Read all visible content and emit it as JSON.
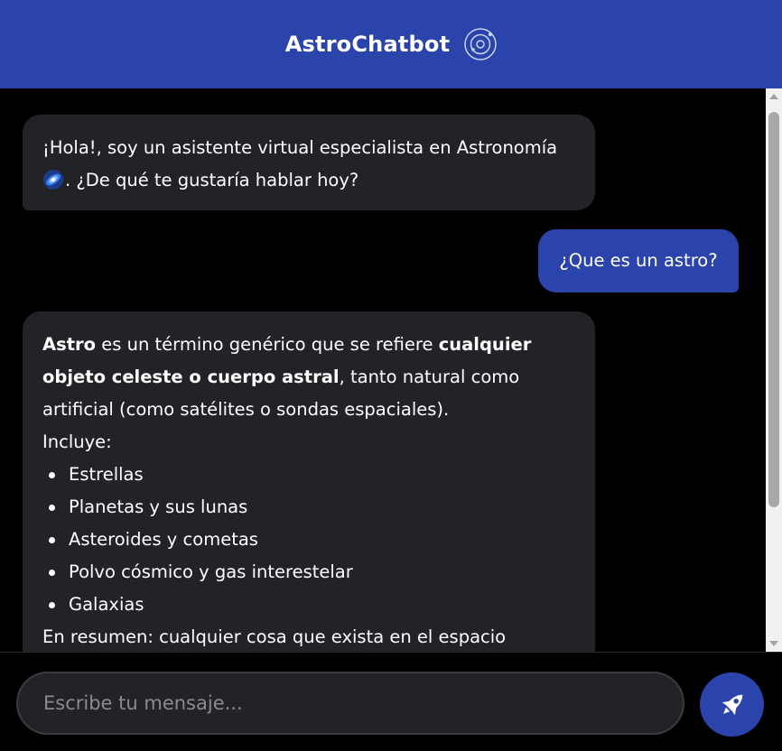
{
  "header": {
    "title": "AstroChatbot",
    "icon": "orbit-icon"
  },
  "messages": [
    {
      "role": "bot",
      "text_before": "¡Hola!, soy un asistente virtual especialista en Astronomía ",
      "emoji": "galaxy-emoji",
      "text_after": ". ¿De qué te gustaría hablar hoy?"
    },
    {
      "role": "user",
      "text": "¿Que es un astro?"
    },
    {
      "role": "bot",
      "intro_bold_1": "Astro",
      "intro_text_1": " es un término genérico que se refiere ",
      "intro_bold_2": "cualquier objeto celeste o cuerpo astral",
      "intro_text_2": ", tanto natural como artificial (como satélites o sondas espaciales).",
      "list_title": "Incluye:",
      "items": [
        "Estrellas",
        "Planetas y sus lunas",
        "Asteroides y cometas",
        "Polvo cósmico y gas interestelar",
        "Galaxias"
      ],
      "summary": "En resumen: cualquier cosa que exista en el espacio"
    }
  ],
  "input": {
    "placeholder": "Escribe tu mensaje...",
    "value": ""
  },
  "send_button": {
    "icon": "rocket-icon"
  },
  "colors": {
    "header_bg": "#2b44ab",
    "user_bubble": "#2b44ab",
    "bot_bubble": "#212327",
    "background": "#000000"
  }
}
